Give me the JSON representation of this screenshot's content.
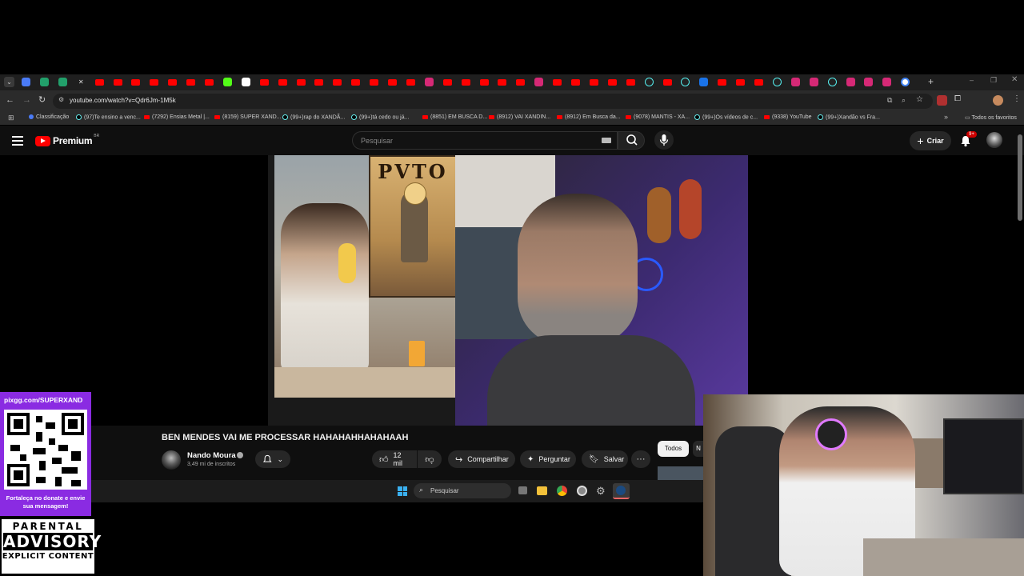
{
  "browser": {
    "url": "youtube.com/watch?v=Qdr6Jm-1M5k",
    "tab_icons": [
      "google-docs-icon",
      "code-icon",
      "code-icon",
      "close-icon",
      "youtube-icon",
      "youtube-icon",
      "youtube-icon",
      "youtube-icon",
      "youtube-icon",
      "youtube-icon",
      "youtube-icon",
      "kick-icon",
      "notion-icon",
      "youtube-icon",
      "youtube-icon",
      "youtube-icon",
      "youtube-icon",
      "youtube-icon",
      "youtube-icon",
      "youtube-icon",
      "youtube-icon",
      "youtube-icon",
      "instagram-icon",
      "youtube-icon",
      "youtube-icon",
      "youtube-icon",
      "youtube-icon",
      "youtube-icon",
      "instagram-icon",
      "youtube-icon",
      "youtube-icon",
      "youtube-icon",
      "youtube-icon",
      "youtube-icon",
      "tiktok-icon",
      "youtube-icon",
      "tiktok-icon",
      "tab-icon",
      "youtube-icon",
      "youtube-icon",
      "youtube-icon",
      "tiktok-icon",
      "instagram-icon",
      "instagram-icon",
      "tiktok-icon",
      "instagram-icon",
      "instagram-icon",
      "instagram-icon",
      "google-icon"
    ],
    "bookmarks": [
      {
        "label": "Classificação",
        "kind": "doc"
      },
      {
        "label": "(97)Te ensino a venc...",
        "kind": "tiktok"
      },
      {
        "label": "(7292) Ensias Metal |...",
        "kind": "yt"
      },
      {
        "label": "(8159) SUPER XAND...",
        "kind": "yt"
      },
      {
        "label": "(99+)rap do XANDÃ...",
        "kind": "tiktok"
      },
      {
        "label": "(99+)tá cedo ou já...",
        "kind": "tiktok"
      },
      {
        "label": "(8851) EM BUSCA D...",
        "kind": "yt"
      },
      {
        "label": "(8912) VAI XANDIN...",
        "kind": "yt"
      },
      {
        "label": "(8912) Em Busca da...",
        "kind": "yt"
      },
      {
        "label": "(9078) MANTIS - XA...",
        "kind": "yt"
      },
      {
        "label": "(99+)Os vídeos de c...",
        "kind": "tiktok"
      },
      {
        "label": "(9338) YouTube",
        "kind": "yt"
      },
      {
        "label": "(99+)Xandão vs Fra...",
        "kind": "tiktok"
      }
    ],
    "all_favorites": "Todos os favoritos"
  },
  "youtube": {
    "logo_text": "Premium",
    "logo_country": "BR",
    "search_placeholder": "Pesquisar",
    "create_label": "Criar",
    "notif_count": "9+",
    "video_poster_text": "PVTO",
    "title": "BEN MENDES VAI ME PROCESSAR HAHAHAHHAHAHAAH",
    "channel_name": "Nando Moura",
    "subscribers": "3,49 mi de inscritos",
    "likes": "12 mil",
    "share_label": "Compartilhar",
    "ask_label": "Perguntar",
    "save_label": "Salvar",
    "chip_all": "Todos",
    "chip_next": "N"
  },
  "taskbar": {
    "search_placeholder": "Pesquisar"
  },
  "overlay": {
    "pix_url": "pixgg.com/SUPERXAND",
    "donate_text": "Fortaleça no donate e envie sua mensagem!",
    "advisory_line1": "PARENTAL",
    "advisory_line2": "ADVISORY",
    "advisory_line3": "EXPLICIT CONTENT"
  },
  "colors": {
    "youtube_red": "#ff0000",
    "overlay_purple": "#8a2be2",
    "background": "#0f0f0f"
  }
}
